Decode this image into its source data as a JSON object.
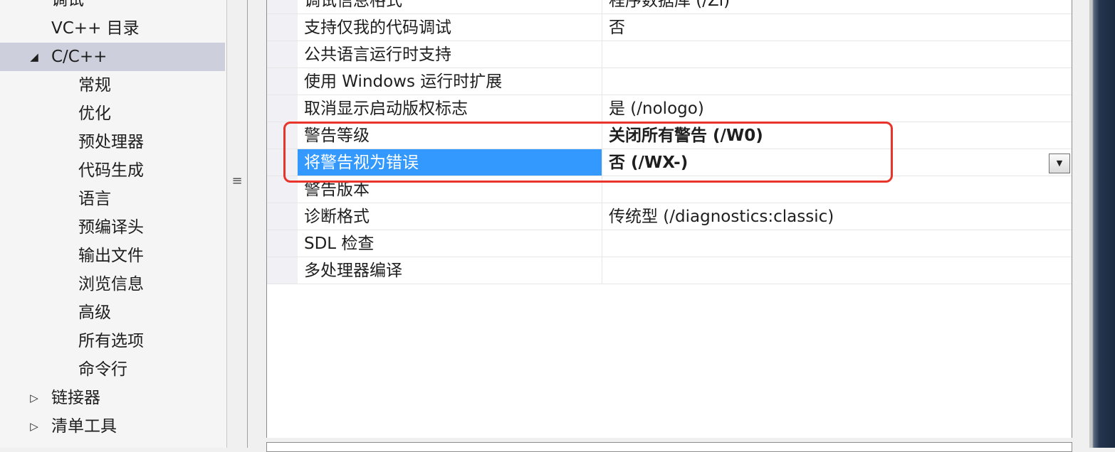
{
  "tree": {
    "items": [
      {
        "label": "调试",
        "level": 1,
        "state": "none"
      },
      {
        "label": "VC++ 目录",
        "level": 1,
        "state": "none"
      },
      {
        "label": "C/C++",
        "level": 1,
        "state": "expanded",
        "selected": true
      },
      {
        "label": "常规",
        "level": 2,
        "state": "none"
      },
      {
        "label": "优化",
        "level": 2,
        "state": "none"
      },
      {
        "label": "预处理器",
        "level": 2,
        "state": "none"
      },
      {
        "label": "代码生成",
        "level": 2,
        "state": "none"
      },
      {
        "label": "语言",
        "level": 2,
        "state": "none"
      },
      {
        "label": "预编译头",
        "level": 2,
        "state": "none"
      },
      {
        "label": "输出文件",
        "level": 2,
        "state": "none"
      },
      {
        "label": "浏览信息",
        "level": 2,
        "state": "none"
      },
      {
        "label": "高级",
        "level": 2,
        "state": "none"
      },
      {
        "label": "所有选项",
        "level": 2,
        "state": "none"
      },
      {
        "label": "命令行",
        "level": 2,
        "state": "none"
      },
      {
        "label": "链接器",
        "level": 1,
        "state": "collapsed"
      },
      {
        "label": "清单工具",
        "level": 1,
        "state": "collapsed"
      }
    ],
    "expanded_glyph": "◢",
    "collapsed_glyph": "▷"
  },
  "splitter": {
    "grip_glyph": "≡"
  },
  "properties": {
    "rows": [
      {
        "name": "调试信息格式",
        "value": "程序数据库 (/Zi)",
        "bold": false
      },
      {
        "name": "支持仅我的代码调试",
        "value": "否",
        "bold": false
      },
      {
        "name": "公共语言运行时支持",
        "value": "",
        "bold": false
      },
      {
        "name": "使用 Windows 运行时扩展",
        "value": "",
        "bold": false
      },
      {
        "name": "取消显示启动版权标志",
        "value": "是 (/nologo)",
        "bold": false
      },
      {
        "name": "警告等级",
        "value": "关闭所有警告 (/W0)",
        "bold": true
      },
      {
        "name": "将警告视为错误",
        "value": "否 (/WX-)",
        "bold": true,
        "selected": true,
        "has_dropdown": true
      },
      {
        "name": "警告版本",
        "value": "",
        "bold": false
      },
      {
        "name": "诊断格式",
        "value": "传统型 (/diagnostics:classic)",
        "bold": false
      },
      {
        "name": "SDL 检查",
        "value": "",
        "bold": false
      },
      {
        "name": "多处理器编译",
        "value": "",
        "bold": false
      }
    ],
    "dropdown_glyph": "▼"
  },
  "colors": {
    "selection": "#3399ff",
    "tree_selection": "#cdd0dc",
    "highlight_box": "#e8342a"
  }
}
